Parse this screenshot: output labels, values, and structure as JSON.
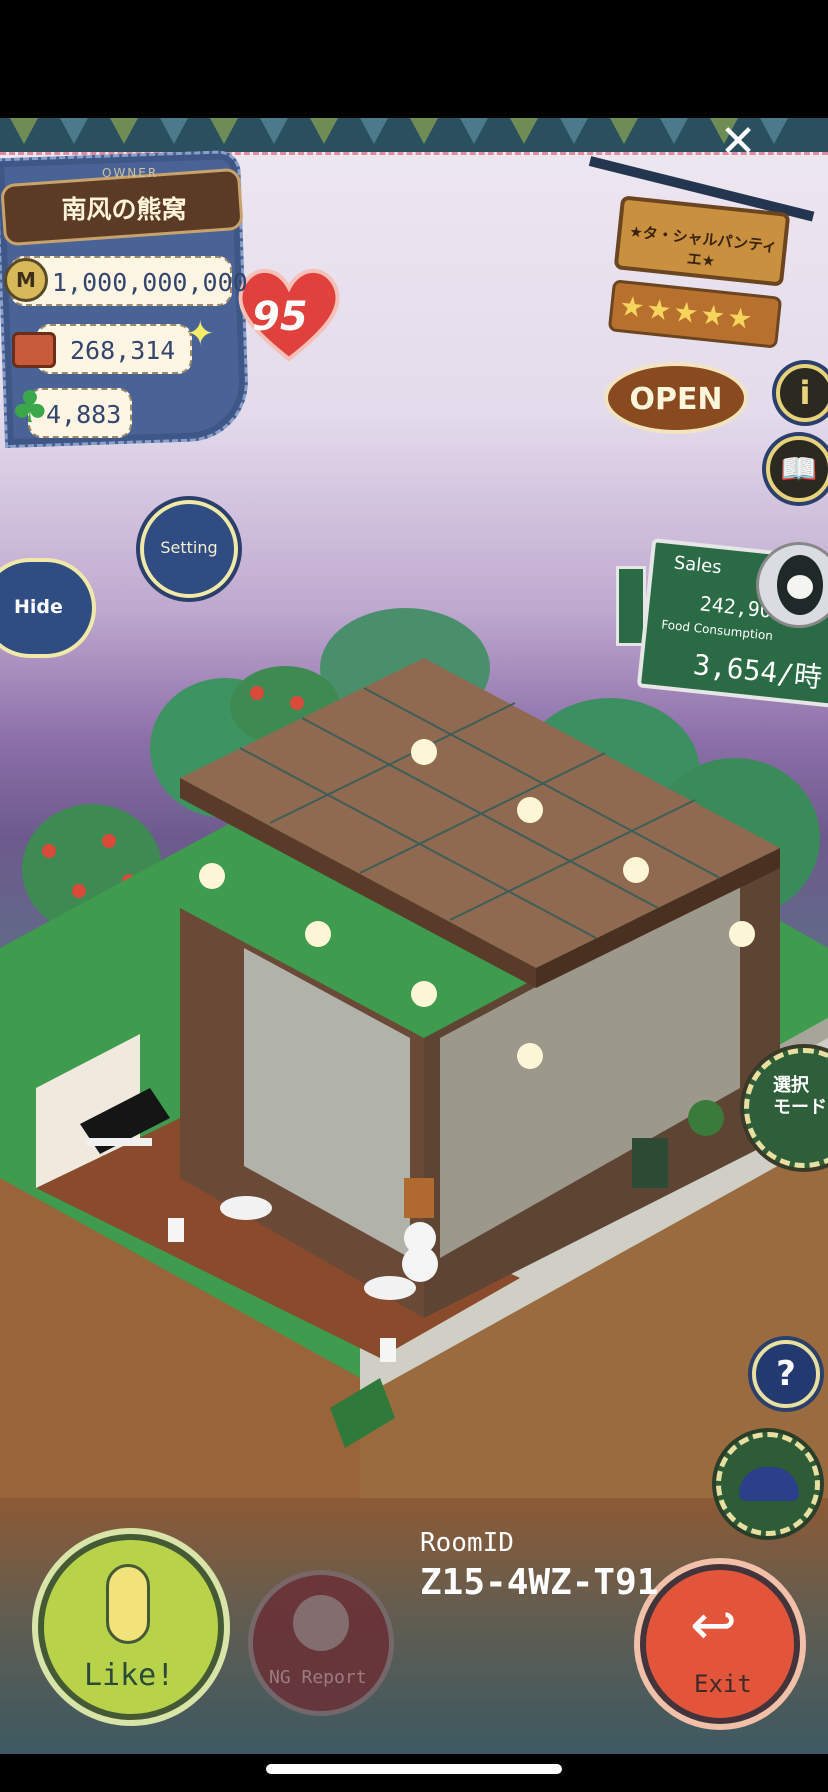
{
  "owner": {
    "tag": "OWNER",
    "name": "南风の熊窝",
    "heart_count": "95"
  },
  "stats": {
    "money": "1,000,000,000",
    "money_icon": "M",
    "food": "268,314",
    "clover": "4,883"
  },
  "buttons": {
    "setting": "Setting",
    "hide": "Hide",
    "like": "Like!",
    "report": "NG Report",
    "exit": "Exit",
    "mode_line1": "選択",
    "mode_line2": "モード",
    "help": "?",
    "info": "i",
    "close": "✕"
  },
  "shop": {
    "name": "★タ・シャルパンティエ★",
    "stars": "★★★★★",
    "open": "OPEN"
  },
  "sales": {
    "title": "Sales",
    "value": "242,901/時",
    "food_label": "Food Consumption",
    "food_value": "3,654/時"
  },
  "room": {
    "label": "RoomID",
    "id": "Z15-4WZ-T91"
  },
  "colors": {
    "denim": "#4a6396",
    "like": "#b8d34a",
    "exit": "#e3553a",
    "board": "#2a6b45"
  }
}
